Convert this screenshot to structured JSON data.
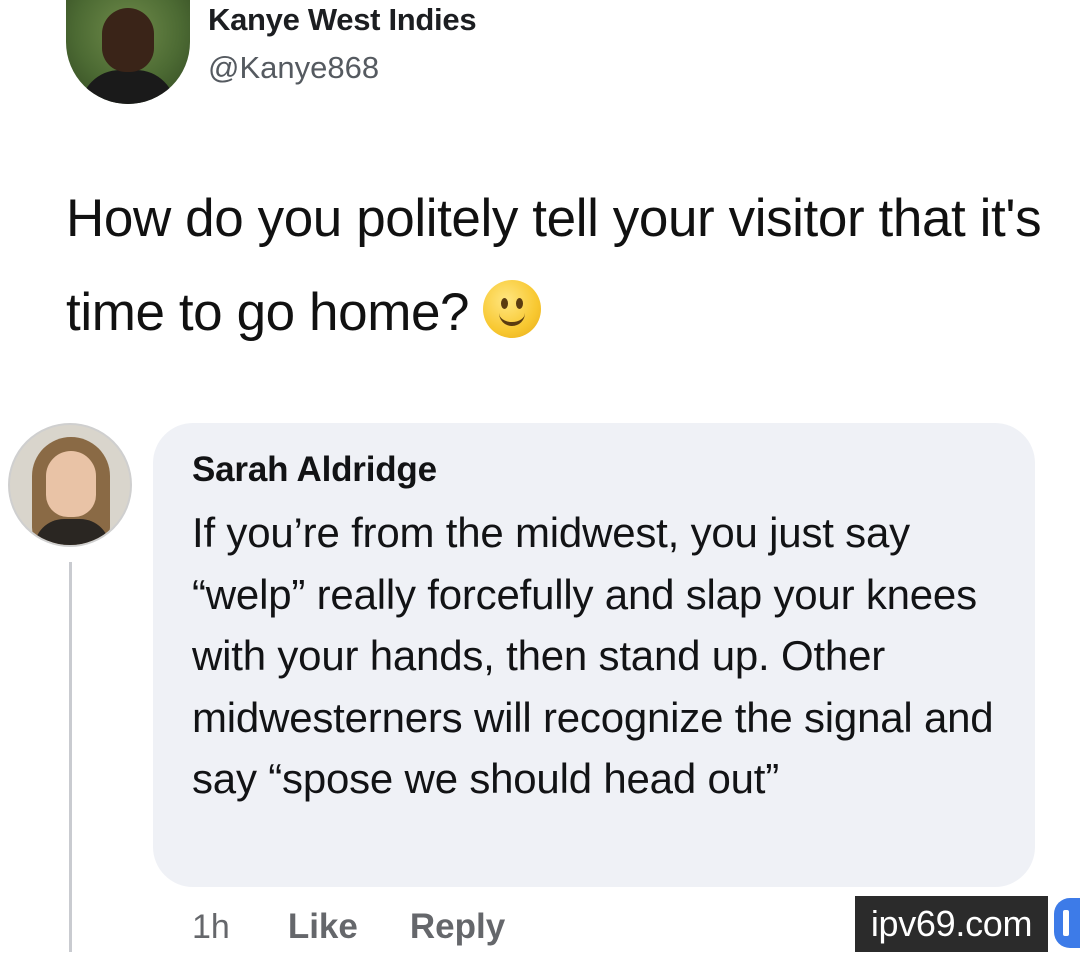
{
  "tweet": {
    "author_name": "Kanye West Indies",
    "author_handle": "@Kanye868",
    "text": "How do you politely tell your visitor that it's time to go home?",
    "emoji": "slightly-smiling-face-icon"
  },
  "comment": {
    "author_name": "Sarah Aldridge",
    "text": "If you’re from the midwest, you just say “welp” really forcefully and slap your knees with your hands, then stand up. Other midwesterners will recognize the signal and say “spose we should head out”",
    "time": "1h",
    "like_label": "Like",
    "reply_label": "Reply"
  },
  "watermark": {
    "text": "ipv69.com"
  },
  "colors": {
    "bubble_bg": "#eff1f6",
    "meta_text": "#65676b",
    "thread_line": "#c9cbd0",
    "watermark_bg": "#2b2b2b"
  }
}
